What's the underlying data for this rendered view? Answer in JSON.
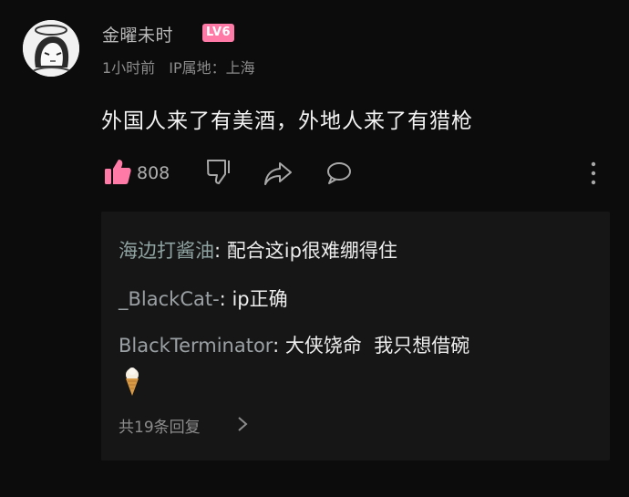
{
  "comment": {
    "username": "金曜未时",
    "level": "LV6",
    "time": "1小时前",
    "ip_location": "IP属地：上海",
    "text": "外国人来了有美酒，外地人来了有猎枪",
    "like_count": "808",
    "colors": {
      "background": "#0c0c0c",
      "level_badge": "#ff7aa6",
      "like_icon": "#ff7aa6",
      "reply_box": "#161616"
    },
    "icons": [
      "avatar",
      "like-icon",
      "dislike-icon",
      "share-icon",
      "reply-icon",
      "more-icon"
    ]
  },
  "replies": {
    "items": [
      {
        "author": "海边打酱油",
        "text": "配合这ip很难绷得住"
      },
      {
        "author": "_BlackCat-",
        "text": "ip正确"
      },
      {
        "author": "BlackTerminator",
        "text": "大侠饶命  我只想借碗"
      }
    ],
    "emoji": "ice-cream-icon",
    "more_label": "共19条回复"
  }
}
